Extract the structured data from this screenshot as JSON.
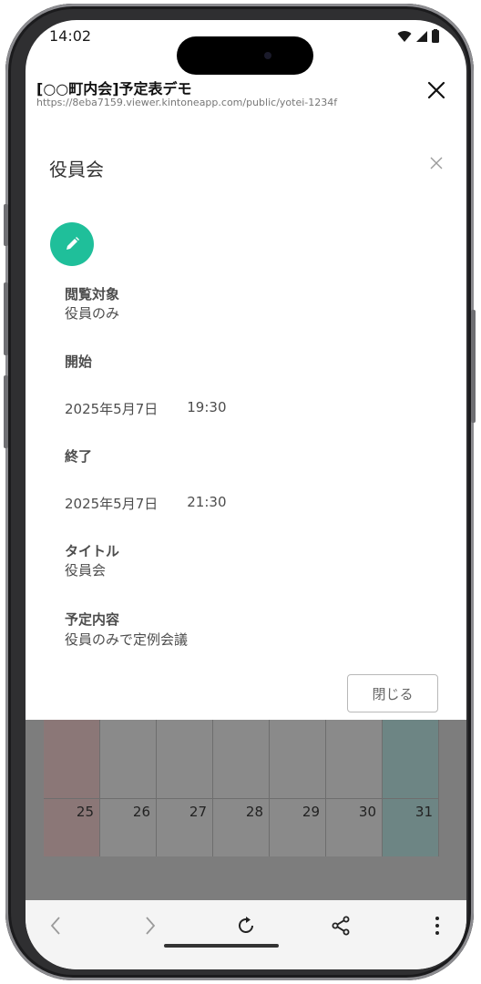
{
  "status_bar": {
    "time": "14:02"
  },
  "browser": {
    "page_title": "[○○町内会]予定表デモ",
    "url": "https://8eba7159.viewer.kintoneapp.com/public/yotei-1234f"
  },
  "modal": {
    "title": "役員会",
    "fields": {
      "audience": {
        "label": "閲覧対象",
        "value": "役員のみ"
      },
      "start": {
        "label": "開始",
        "date": "2025年5月7日",
        "time": "19:30"
      },
      "end": {
        "label": "終了",
        "date": "2025年5月7日",
        "time": "21:30"
      },
      "title": {
        "label": "タイトル",
        "value": "役員会"
      },
      "content": {
        "label": "予定内容",
        "value": "役員のみで定例会議"
      }
    },
    "close_button": "閉じる"
  },
  "calendar": {
    "days": [
      "25",
      "26",
      "27",
      "28",
      "29",
      "30",
      "31"
    ]
  },
  "colors": {
    "accent": "#1fbf9a",
    "sunday": "#8b7777",
    "saturday": "#6d8584"
  }
}
